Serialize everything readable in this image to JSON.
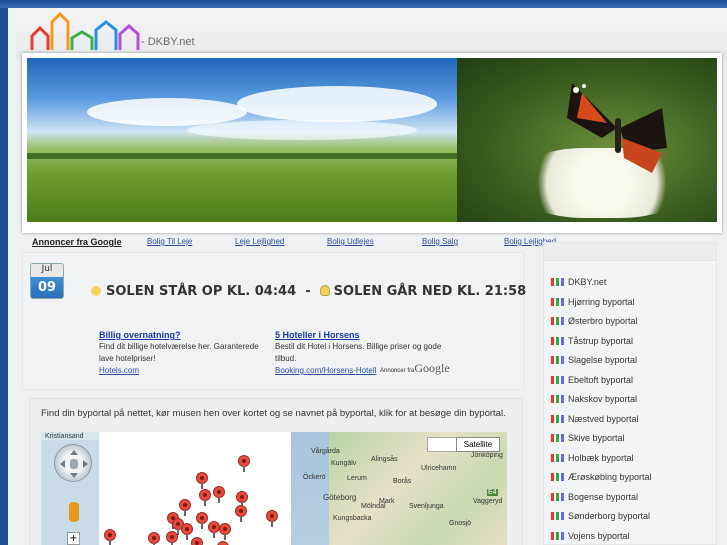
{
  "site": {
    "name": "- DKBY.net"
  },
  "ads_bar": {
    "lead": "Annoncer fra Google",
    "links": [
      "Bolig Til Leje",
      "Leje Lejlighed",
      "Bolig Udlejes",
      "Bolig Salg",
      "Bolig Lejlighed"
    ]
  },
  "date": {
    "month": "Jul",
    "day": "09"
  },
  "sun": {
    "rise": "SOLEN STÅR OP KL. 04:44",
    "separator": "-",
    "set": "SOLEN GÅR NED KL. 21:58"
  },
  "ads": [
    {
      "title": "Billig overnatning?",
      "text": "Find dit billige hotelværelse her. Garanterede lave hotelpriser!",
      "url": "Hotels.com"
    },
    {
      "title": "5 Hoteller i Horsens",
      "text": "Bestil dit Hotel i Horsens. Billige priser og gode tilbud.",
      "url": "Booking.com/Horsens-Hotell"
    }
  ],
  "ads_by": {
    "prefix": "Annoncer fra",
    "brand": "Google"
  },
  "map": {
    "intro": "Find din byportal på nettet, kør musen hen over kortet og se navnet på byportal, klik for at besøge din byportal.",
    "satellite_label": "Satellite",
    "place_labels": [
      "Kristiansand",
      "Kungälv",
      "Alingsås",
      "Ulricehamn",
      "Jönköping",
      "Borås",
      "Göteborg",
      "Mark",
      "Svenljunga",
      "Vaggeryd",
      "Kungsbacka",
      "Gnosjö",
      "Vårgårda",
      "Öckerö",
      "Lerum",
      "Mölndal",
      "E4"
    ]
  },
  "sidebar": {
    "items": [
      "DKBY.net",
      "Hjørring byportal",
      "Østerbro byportal",
      "Tåstrup byportal",
      "Slagelse byportal",
      "Ebeltoft byportal",
      "Nakskov byportal",
      "Næstved byportal",
      "Skive byportal",
      "Holbæk byportal",
      "Ærøskøbing byportal",
      "Bogense byportal",
      "Sønderborg byportal",
      "Vojens byportal"
    ]
  }
}
